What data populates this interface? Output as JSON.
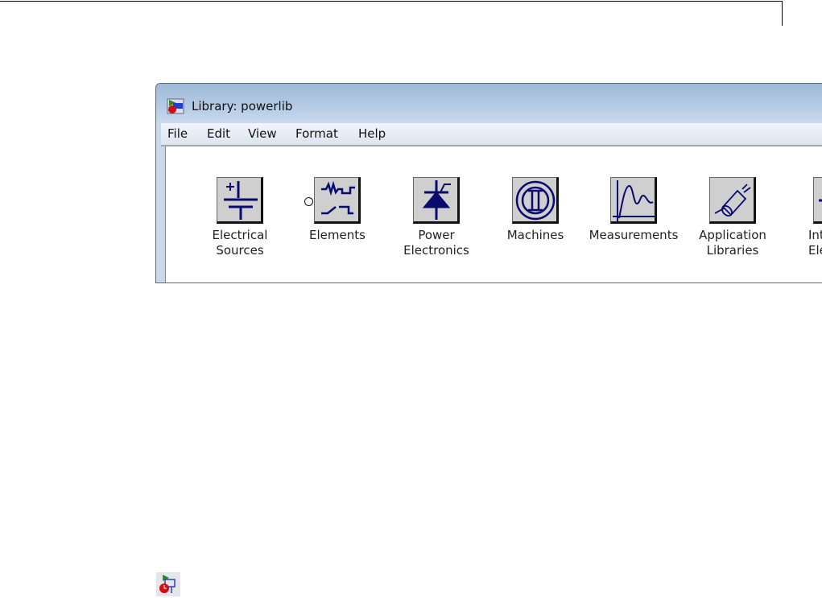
{
  "window": {
    "title": "Library: powerlib",
    "app_icon": "simulink-library-icon"
  },
  "menu": [
    "File",
    "Edit",
    "View",
    "Format",
    "Help"
  ],
  "blocks": [
    {
      "label1": "Electrical",
      "label2": "Sources",
      "icon": "dc-voltage-source-icon"
    },
    {
      "label1": "Elements",
      "label2": "",
      "icon": "rlc-elements-icon"
    },
    {
      "label1": "Power",
      "label2": "Electronics",
      "icon": "thyristor-icon"
    },
    {
      "label1": "Machines",
      "label2": "",
      "icon": "machine-icon"
    },
    {
      "label1": "Measurements",
      "label2": "",
      "icon": "waveform-icon"
    },
    {
      "label1": "Application",
      "label2": "Libraries",
      "icon": "motor-icon"
    },
    {
      "label1": "Inte",
      "label2": "Ele",
      "icon": "partial-block-icon"
    }
  ],
  "colors": {
    "icon_stroke": "#0a0a6e",
    "titlebar": "#a9c2de"
  },
  "bottom_icon": "simulink-library-icon"
}
